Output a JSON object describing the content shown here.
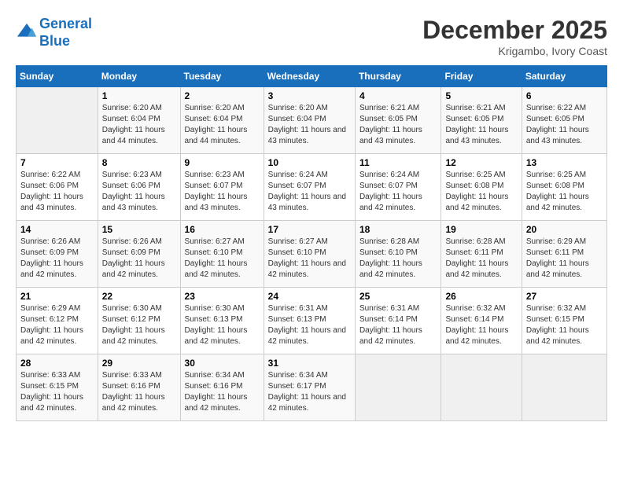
{
  "header": {
    "logo_line1": "General",
    "logo_line2": "Blue",
    "month_title": "December 2025",
    "location": "Krigambo, Ivory Coast"
  },
  "days_of_week": [
    "Sunday",
    "Monday",
    "Tuesday",
    "Wednesday",
    "Thursday",
    "Friday",
    "Saturday"
  ],
  "weeks": [
    [
      {
        "day": "",
        "info": ""
      },
      {
        "day": "1",
        "info": "Sunrise: 6:20 AM\nSunset: 6:04 PM\nDaylight: 11 hours and 44 minutes."
      },
      {
        "day": "2",
        "info": "Sunrise: 6:20 AM\nSunset: 6:04 PM\nDaylight: 11 hours and 44 minutes."
      },
      {
        "day": "3",
        "info": "Sunrise: 6:20 AM\nSunset: 6:04 PM\nDaylight: 11 hours and 43 minutes."
      },
      {
        "day": "4",
        "info": "Sunrise: 6:21 AM\nSunset: 6:05 PM\nDaylight: 11 hours and 43 minutes."
      },
      {
        "day": "5",
        "info": "Sunrise: 6:21 AM\nSunset: 6:05 PM\nDaylight: 11 hours and 43 minutes."
      },
      {
        "day": "6",
        "info": "Sunrise: 6:22 AM\nSunset: 6:05 PM\nDaylight: 11 hours and 43 minutes."
      }
    ],
    [
      {
        "day": "7",
        "info": "Sunrise: 6:22 AM\nSunset: 6:06 PM\nDaylight: 11 hours and 43 minutes."
      },
      {
        "day": "8",
        "info": "Sunrise: 6:23 AM\nSunset: 6:06 PM\nDaylight: 11 hours and 43 minutes."
      },
      {
        "day": "9",
        "info": "Sunrise: 6:23 AM\nSunset: 6:07 PM\nDaylight: 11 hours and 43 minutes."
      },
      {
        "day": "10",
        "info": "Sunrise: 6:24 AM\nSunset: 6:07 PM\nDaylight: 11 hours and 43 minutes."
      },
      {
        "day": "11",
        "info": "Sunrise: 6:24 AM\nSunset: 6:07 PM\nDaylight: 11 hours and 42 minutes."
      },
      {
        "day": "12",
        "info": "Sunrise: 6:25 AM\nSunset: 6:08 PM\nDaylight: 11 hours and 42 minutes."
      },
      {
        "day": "13",
        "info": "Sunrise: 6:25 AM\nSunset: 6:08 PM\nDaylight: 11 hours and 42 minutes."
      }
    ],
    [
      {
        "day": "14",
        "info": "Sunrise: 6:26 AM\nSunset: 6:09 PM\nDaylight: 11 hours and 42 minutes."
      },
      {
        "day": "15",
        "info": "Sunrise: 6:26 AM\nSunset: 6:09 PM\nDaylight: 11 hours and 42 minutes."
      },
      {
        "day": "16",
        "info": "Sunrise: 6:27 AM\nSunset: 6:10 PM\nDaylight: 11 hours and 42 minutes."
      },
      {
        "day": "17",
        "info": "Sunrise: 6:27 AM\nSunset: 6:10 PM\nDaylight: 11 hours and 42 minutes."
      },
      {
        "day": "18",
        "info": "Sunrise: 6:28 AM\nSunset: 6:10 PM\nDaylight: 11 hours and 42 minutes."
      },
      {
        "day": "19",
        "info": "Sunrise: 6:28 AM\nSunset: 6:11 PM\nDaylight: 11 hours and 42 minutes."
      },
      {
        "day": "20",
        "info": "Sunrise: 6:29 AM\nSunset: 6:11 PM\nDaylight: 11 hours and 42 minutes."
      }
    ],
    [
      {
        "day": "21",
        "info": "Sunrise: 6:29 AM\nSunset: 6:12 PM\nDaylight: 11 hours and 42 minutes."
      },
      {
        "day": "22",
        "info": "Sunrise: 6:30 AM\nSunset: 6:12 PM\nDaylight: 11 hours and 42 minutes."
      },
      {
        "day": "23",
        "info": "Sunrise: 6:30 AM\nSunset: 6:13 PM\nDaylight: 11 hours and 42 minutes."
      },
      {
        "day": "24",
        "info": "Sunrise: 6:31 AM\nSunset: 6:13 PM\nDaylight: 11 hours and 42 minutes."
      },
      {
        "day": "25",
        "info": "Sunrise: 6:31 AM\nSunset: 6:14 PM\nDaylight: 11 hours and 42 minutes."
      },
      {
        "day": "26",
        "info": "Sunrise: 6:32 AM\nSunset: 6:14 PM\nDaylight: 11 hours and 42 minutes."
      },
      {
        "day": "27",
        "info": "Sunrise: 6:32 AM\nSunset: 6:15 PM\nDaylight: 11 hours and 42 minutes."
      }
    ],
    [
      {
        "day": "28",
        "info": "Sunrise: 6:33 AM\nSunset: 6:15 PM\nDaylight: 11 hours and 42 minutes."
      },
      {
        "day": "29",
        "info": "Sunrise: 6:33 AM\nSunset: 6:16 PM\nDaylight: 11 hours and 42 minutes."
      },
      {
        "day": "30",
        "info": "Sunrise: 6:34 AM\nSunset: 6:16 PM\nDaylight: 11 hours and 42 minutes."
      },
      {
        "day": "31",
        "info": "Sunrise: 6:34 AM\nSunset: 6:17 PM\nDaylight: 11 hours and 42 minutes."
      },
      {
        "day": "",
        "info": ""
      },
      {
        "day": "",
        "info": ""
      },
      {
        "day": "",
        "info": ""
      }
    ]
  ]
}
